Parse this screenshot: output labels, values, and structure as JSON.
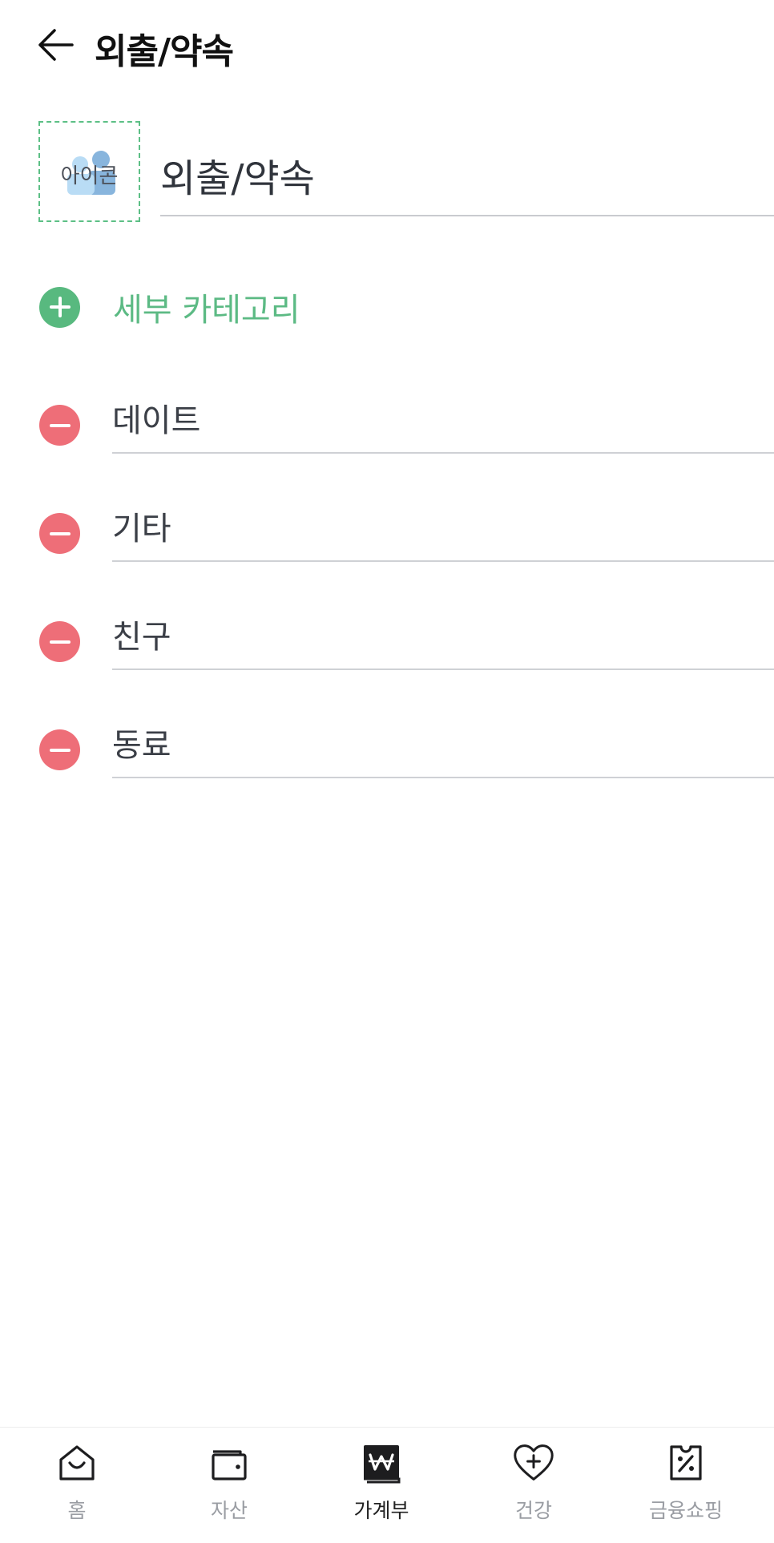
{
  "header": {
    "title": "외출/약속",
    "back_icon": "arrow-left-icon"
  },
  "category": {
    "icon_label": "아이콘",
    "icon_name": "people-icon",
    "name_value": "외출/약속"
  },
  "add_subcategory": {
    "label": "세부 카테고리",
    "icon": "plus-circle-icon"
  },
  "subcategories": [
    {
      "value": "데이트",
      "remove_icon": "minus-circle-icon"
    },
    {
      "value": "기타",
      "remove_icon": "minus-circle-icon"
    },
    {
      "value": "친구",
      "remove_icon": "minus-circle-icon"
    },
    {
      "value": "동료",
      "remove_icon": "minus-circle-icon"
    }
  ],
  "bottom_nav": {
    "items": [
      {
        "label": "홈",
        "icon": "home-icon",
        "active": false
      },
      {
        "label": "자산",
        "icon": "wallet-icon",
        "active": false
      },
      {
        "label": "가계부",
        "icon": "ledger-won-icon",
        "active": true
      },
      {
        "label": "건강",
        "icon": "heart-plus-icon",
        "active": false
      },
      {
        "label": "금융쇼핑",
        "icon": "coupon-percent-icon",
        "active": false
      }
    ]
  },
  "colors": {
    "accent_green": "#58b97f",
    "remove_red": "#ee6e78",
    "text_dark": "#111111",
    "nav_inactive": "#9a9da3"
  }
}
